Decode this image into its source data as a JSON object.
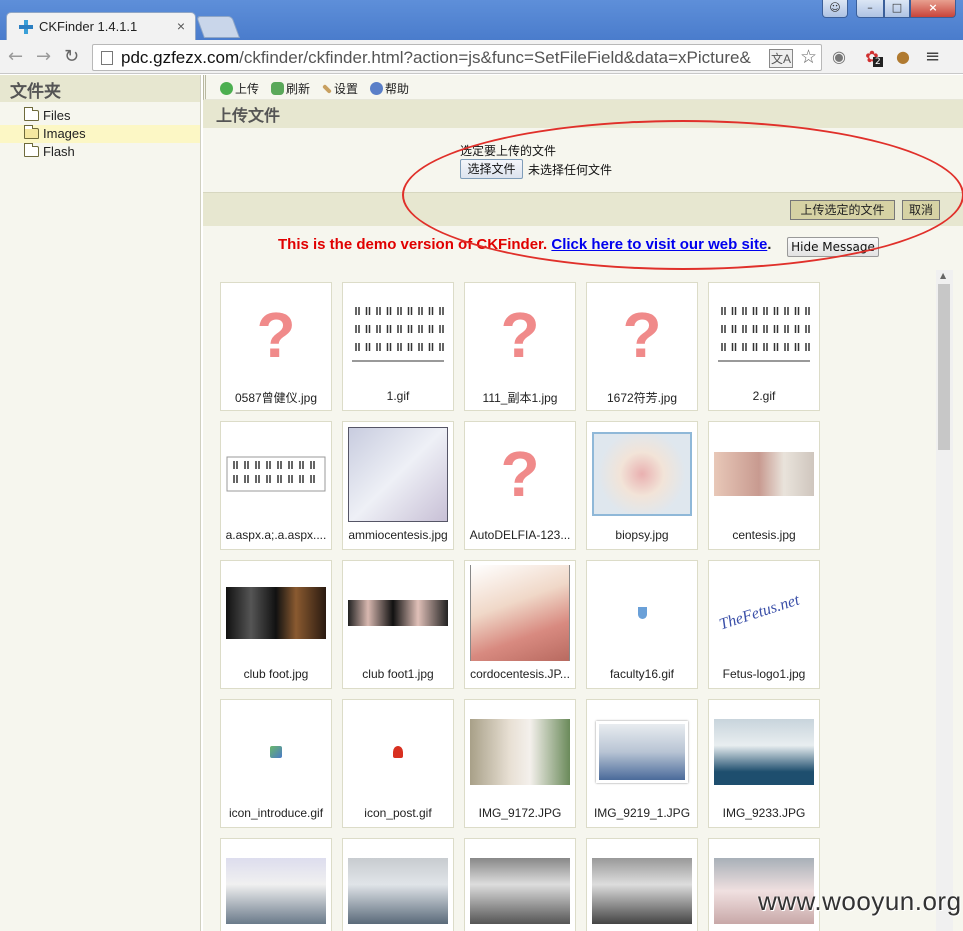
{
  "browser": {
    "tab_title": "CKFinder 1.4.1.1",
    "tab_close": "×",
    "url_host": "pdc.gzfezx.com",
    "url_path": "/ckfinder/ckfinder.html?action=js&func=SetFileField&data=xPicture&",
    "ext_badge": "2"
  },
  "sidebar": {
    "header": "文件夹",
    "folders": [
      "Files",
      "Images",
      "Flash"
    ]
  },
  "toolbar": {
    "upload": "上传",
    "refresh": "刷新",
    "settings": "设置",
    "help": "帮助"
  },
  "upload": {
    "title": "上传文件",
    "label": "选定要上传的文件",
    "choose_button": "选择文件",
    "no_file": "未选择任何文件",
    "submit": "上传选定的文件",
    "cancel": "取消"
  },
  "demo": {
    "text": "This is the demo version of CKFinder.",
    "link": "Click here to visit our web site",
    "period": ".",
    "hide_button": "Hide Message"
  },
  "files": [
    {
      "name": "0587曾健仪.jpg",
      "kind": "unknown"
    },
    {
      "name": "1.gif",
      "kind": "karyotype"
    },
    {
      "name": "111_副本1.jpg",
      "kind": "unknown"
    },
    {
      "name": "1672符芳.jpg",
      "kind": "unknown"
    },
    {
      "name": "2.gif",
      "kind": "karyotype"
    },
    {
      "name": "a.aspx.a;.a.aspx....",
      "kind": "karyotype2"
    },
    {
      "name": "ammiocentesis.jpg",
      "kind": "medical"
    },
    {
      "name": "AutoDELFIA-123...",
      "kind": "unknown"
    },
    {
      "name": "biopsy.jpg",
      "kind": "medical2"
    },
    {
      "name": "centesis.jpg",
      "kind": "medical3"
    },
    {
      "name": "club foot.jpg",
      "kind": "ultrasound"
    },
    {
      "name": "club foot1.jpg",
      "kind": "ultrasound2"
    },
    {
      "name": "cordocentesis.JP...",
      "kind": "medical4"
    },
    {
      "name": "faculty16.gif",
      "kind": "tinyicon"
    },
    {
      "name": "Fetus-logo1.jpg",
      "kind": "logo"
    },
    {
      "name": "icon_introduce.gif",
      "kind": "tinyicon2"
    },
    {
      "name": "icon_post.gif",
      "kind": "tinyicon3"
    },
    {
      "name": "IMG_9172.JPG",
      "kind": "photo"
    },
    {
      "name": "IMG_9219_1.JPG",
      "kind": "photo2"
    },
    {
      "name": "IMG_9233.JPG",
      "kind": "photo3"
    },
    {
      "name": "",
      "kind": "photo4"
    },
    {
      "name": "",
      "kind": "photo5"
    },
    {
      "name": "",
      "kind": "photo6"
    },
    {
      "name": "",
      "kind": "photo7"
    },
    {
      "name": "",
      "kind": "photo8"
    }
  ],
  "logo_text": "TheFetus.net",
  "watermark": "www.wooyun.org",
  "colors": {
    "demo_red": "#e00000",
    "link_blue": "#0000ee",
    "annotation_red": "#e0302a",
    "panel_header": "#e7e7d0",
    "question_mark": "#f08a8a"
  }
}
